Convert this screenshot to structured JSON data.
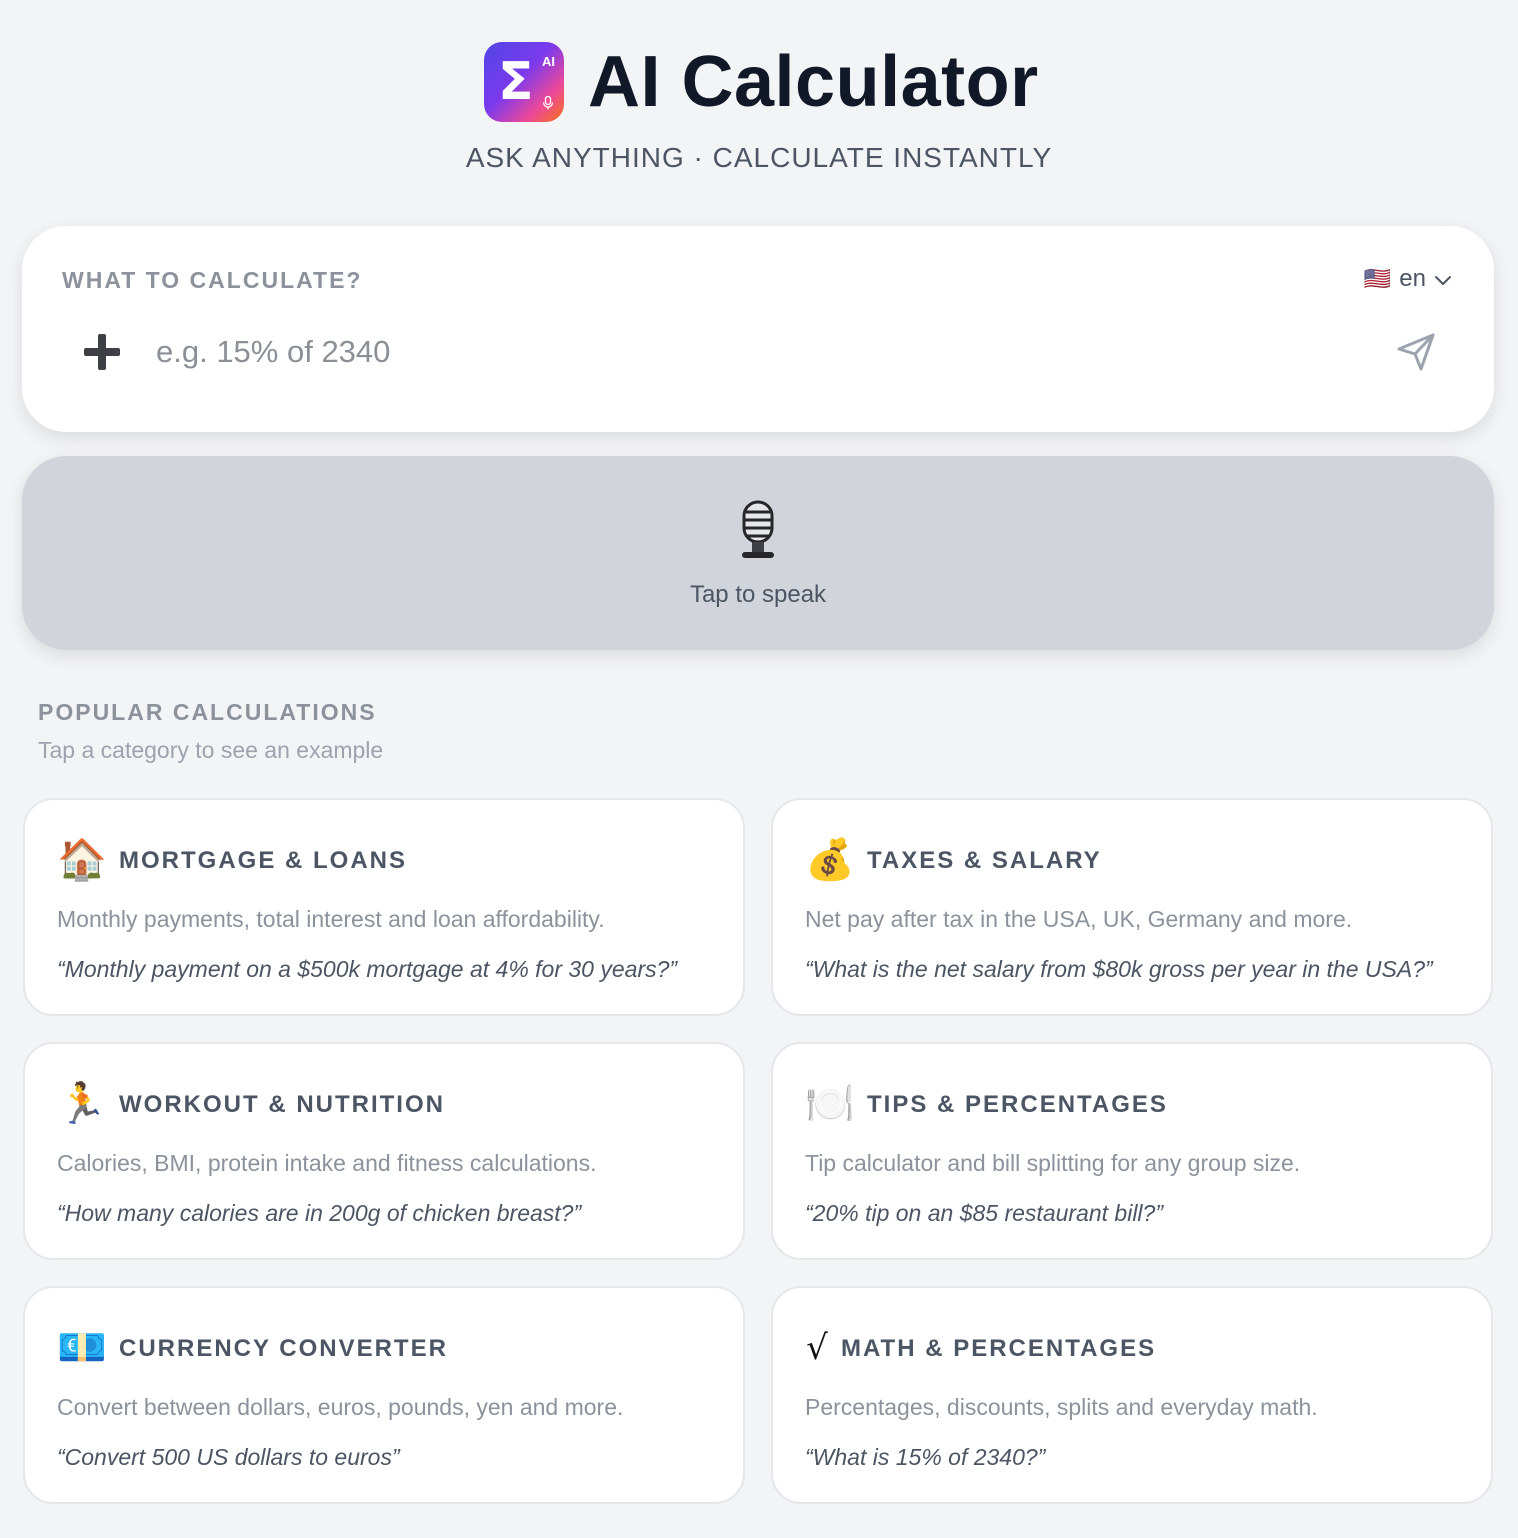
{
  "header": {
    "logo": {
      "glyph": "Σ",
      "badge": "AI",
      "mic": "🎙"
    },
    "title": "AI Calculator",
    "tagline": "ASK ANYTHING · CALCULATE INSTANTLY"
  },
  "input": {
    "label": "WHAT TO CALCULATE?",
    "placeholder": "e.g. 15% of 2340",
    "value": "",
    "language": {
      "flag": "🇺🇸",
      "code": "en"
    }
  },
  "voice": {
    "icon": "🎙️",
    "label": "Tap to speak"
  },
  "popular": {
    "title": "POPULAR CALCULATIONS",
    "subtitle": "Tap a category to see an example",
    "cards": [
      {
        "icon": "🏠",
        "title": "MORTGAGE & LOANS",
        "desc": "Monthly payments, total interest and loan affordability.",
        "example": "“Monthly payment on a $500k mortgage at 4% for 30 years?”"
      },
      {
        "icon": "💰",
        "title": "TAXES & SALARY",
        "desc": "Net pay after tax in the USA, UK, Germany and more.",
        "example": "“What is the net salary from $80k gross per year in the USA?”"
      },
      {
        "icon": "🏃",
        "title": "WORKOUT & NUTRITION",
        "desc": "Calories, BMI, protein intake and fitness calculations.",
        "example": "“How many calories are in 200g of chicken breast?”"
      },
      {
        "icon": "🍽️",
        "title": "TIPS & PERCENTAGES",
        "desc": "Tip calculator and bill splitting for any group size.",
        "example": "“20% tip on an $85 restaurant bill?”"
      },
      {
        "icon": "💶",
        "title": "CURRENCY CONVERTER",
        "desc": "Convert between dollars, euros, pounds, yen and more.",
        "example": "“Convert 500 US dollars to euros”"
      },
      {
        "icon": "√",
        "title": "MATH & PERCENTAGES",
        "desc": "Percentages, discounts, splits and everyday math.",
        "example": "“What is 15% of 2340?”"
      }
    ]
  },
  "colors": {
    "background": "#f3f4f6",
    "accent_gradient": [
      "#4f46e5",
      "#7c3aed",
      "#ec4899",
      "#f97316"
    ],
    "muted_text": "#8b929c",
    "voice_bg": "#d1d5db"
  }
}
